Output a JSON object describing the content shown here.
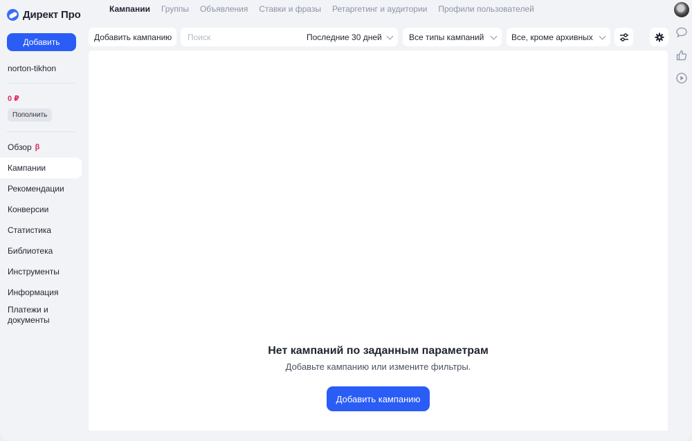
{
  "app": {
    "logo_text": "Директ Про"
  },
  "sidebar": {
    "add_button": "Добавить",
    "username": "norton-tikhon",
    "balance": "0 ₽",
    "topup_button": "Пополнить",
    "nav": [
      {
        "label": "Обзор",
        "badge": "β"
      },
      {
        "label": "Кампании",
        "active": true
      },
      {
        "label": "Рекомендации"
      },
      {
        "label": "Конверсии"
      },
      {
        "label": "Статистика"
      },
      {
        "label": "Библиотека"
      },
      {
        "label": "Инструменты"
      },
      {
        "label": "Информация"
      },
      {
        "label_line1": "Платежи и",
        "label_line2": "документы"
      }
    ]
  },
  "tabs": [
    {
      "label": "Кампании",
      "active": true
    },
    {
      "label": "Группы"
    },
    {
      "label": "Объявления"
    },
    {
      "label": "Ставки и фразы"
    },
    {
      "label": "Ретаргетинг и аудитории"
    },
    {
      "label": "Профили пользователей"
    }
  ],
  "toolbar": {
    "add_campaign": "Добавить кампанию",
    "search_placeholder": "Поиск",
    "search_value": "",
    "period": "Последние 30 дней",
    "campaign_types": "Все типы кампаний",
    "status_filter": "Все, кроме архивных"
  },
  "empty_state": {
    "title": "Нет кампаний по заданным параметрам",
    "subtitle": "Добавьте кампанию или измените фильтры.",
    "button": "Добавить кампанию"
  },
  "icons": {
    "logo": "yandex-direct-logo-icon",
    "search": "search-icon",
    "filters": "filter-sliders-icon",
    "settings": "gear-icon",
    "chat": "chat-bubble-icon",
    "like": "thumbs-up-icon",
    "play": "play-circle-icon"
  },
  "colors": {
    "accent": "#2a5cf6",
    "balance": "#e0245e",
    "background": "#f2f3f6",
    "panel": "#ffffff"
  }
}
